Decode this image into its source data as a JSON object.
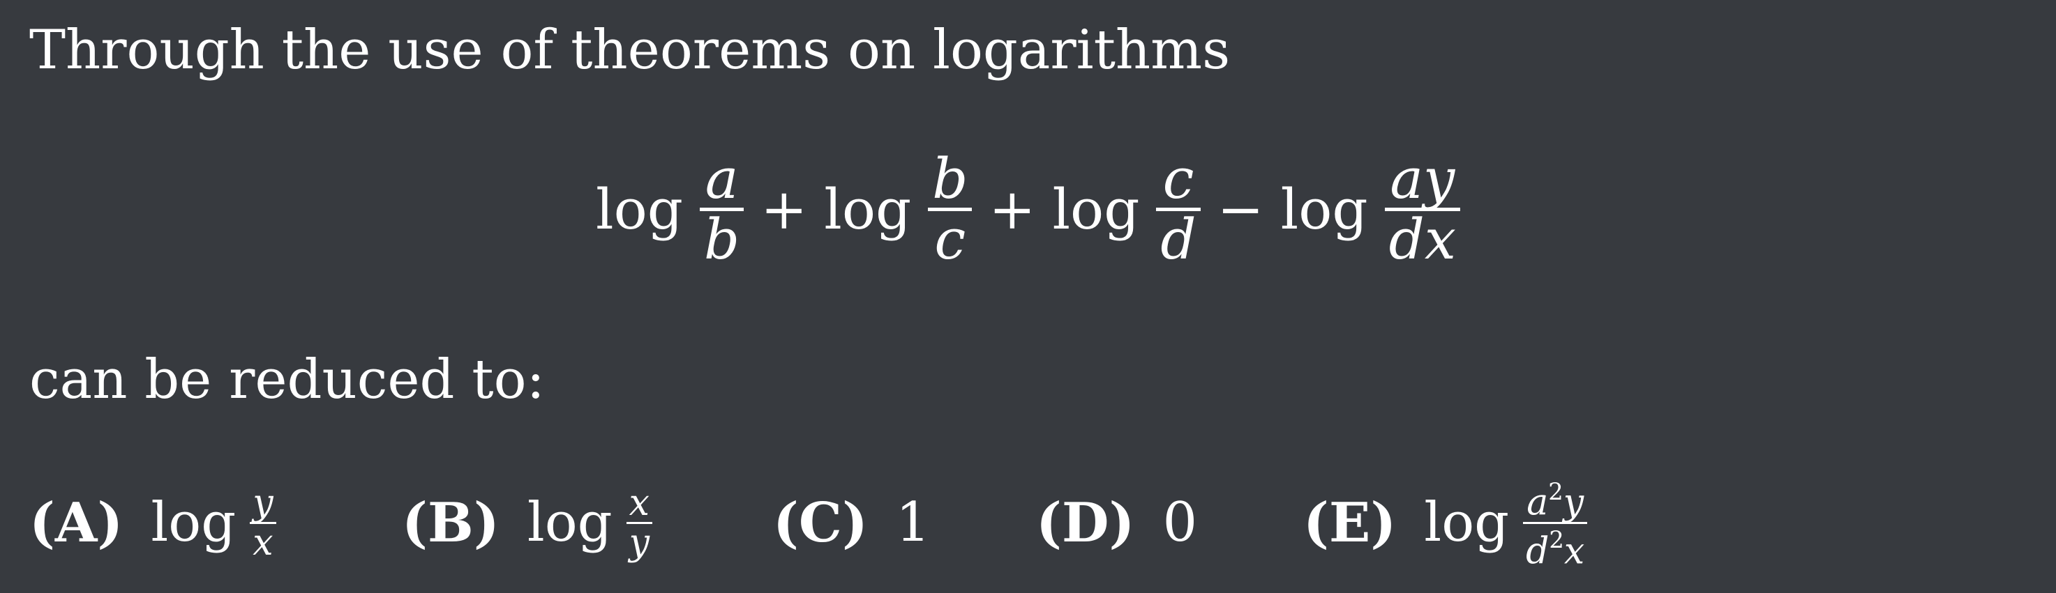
{
  "intro": "Through the use of theorems on logarithms",
  "reduced": "can be reduced to:",
  "equation": {
    "fn": "log",
    "plus": "+",
    "minus": "−",
    "terms": [
      {
        "num": "a",
        "den": "b"
      },
      {
        "num": "b",
        "den": "c"
      },
      {
        "num": "c",
        "den": "d"
      },
      {
        "num": "ay",
        "den": "dx"
      }
    ]
  },
  "choices": [
    {
      "letter": "(A)",
      "fn": "log",
      "num": "y",
      "den": "x"
    },
    {
      "letter": "(B)",
      "fn": "log",
      "num": "x",
      "den": "y"
    },
    {
      "letter": "(C)",
      "value": "1"
    },
    {
      "letter": "(D)",
      "value": "0"
    },
    {
      "letter": "(E)",
      "fn": "log",
      "num_base": "a",
      "num_exp": "2",
      "num_rest": "y",
      "den_base": "d",
      "den_exp": "2",
      "den_rest": "x"
    }
  ]
}
